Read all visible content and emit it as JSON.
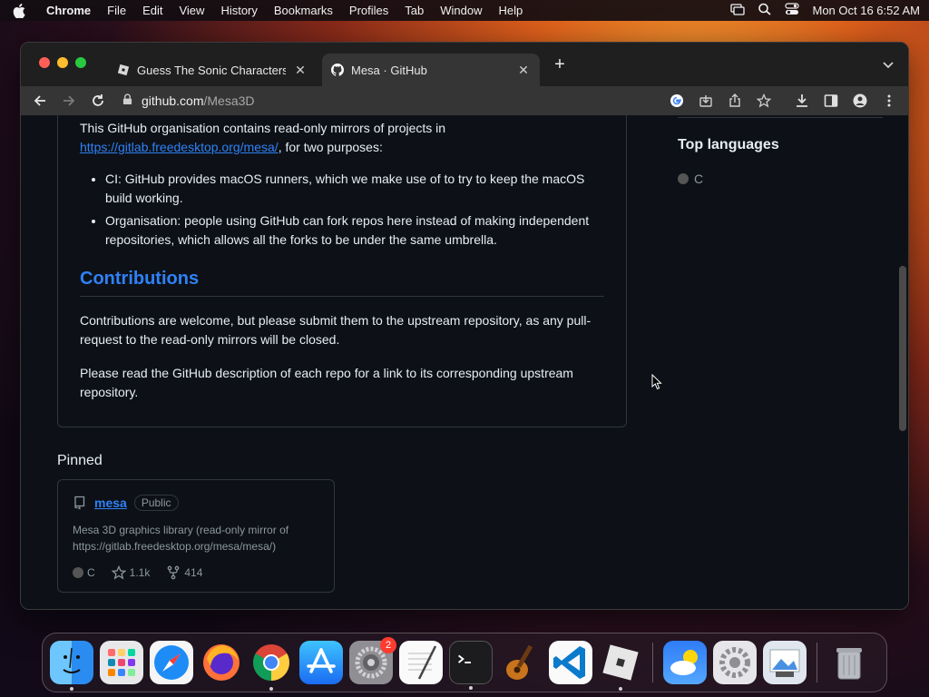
{
  "menubar": {
    "app_name": "Chrome",
    "items": [
      "File",
      "Edit",
      "View",
      "History",
      "Bookmarks",
      "Profiles",
      "Tab",
      "Window",
      "Help"
    ],
    "clock": "Mon Oct 16  6:52 AM"
  },
  "browser": {
    "tabs": [
      {
        "title": "Guess The Sonic Characters! -",
        "favicon": "roblox-icon",
        "active": false
      },
      {
        "title": "Mesa · GitHub",
        "favicon": "github-icon",
        "active": true
      }
    ],
    "url_host": "github.com",
    "url_path": "/Mesa3D"
  },
  "readme": {
    "intro_text": "This GitHub organisation contains read-only mirrors of projects in",
    "intro_link": "https://gitlab.freedesktop.org/mesa/",
    "intro_tail": ", for two purposes:",
    "bullets": [
      "CI: GitHub provides macOS runners, which we make use of to try to keep the macOS build working.",
      "Organisation: people using GitHub can fork repos here instead of making independent repositories, which allows all the forks to be under the same umbrella."
    ],
    "contrib_heading": "Contributions",
    "contrib_p1": "Contributions are welcome, but please submit them to the upstream repository, as any pull-request to the read-only mirrors will be closed.",
    "contrib_p2": "Please read the GitHub description of each repo for a link to its corresponding upstream repository."
  },
  "sidebar": {
    "top_languages_title": "Top languages",
    "languages": [
      {
        "name": "C",
        "color": "#555555"
      }
    ]
  },
  "pinned": {
    "title": "Pinned",
    "repos": [
      {
        "name": "mesa",
        "visibility": "Public",
        "description": "Mesa 3D graphics library (read-only mirror of https://gitlab.freedesktop.org/mesa/mesa/)",
        "language": "C",
        "stars": "1.1k",
        "forks": "414"
      }
    ]
  },
  "dock": {
    "apps": [
      "finder-icon",
      "launchpad-icon",
      "safari-icon",
      "firefox-icon",
      "chrome-icon",
      "app-store-icon",
      "system-preferences-icon",
      "textedit-icon",
      "terminal-icon",
      "garageband-icon",
      "vscode-icon",
      "roblox-icon",
      "weather-icon",
      "settings-gear-icon",
      "preview-icon",
      "trash-icon"
    ],
    "system_prefs_badge": "2"
  }
}
